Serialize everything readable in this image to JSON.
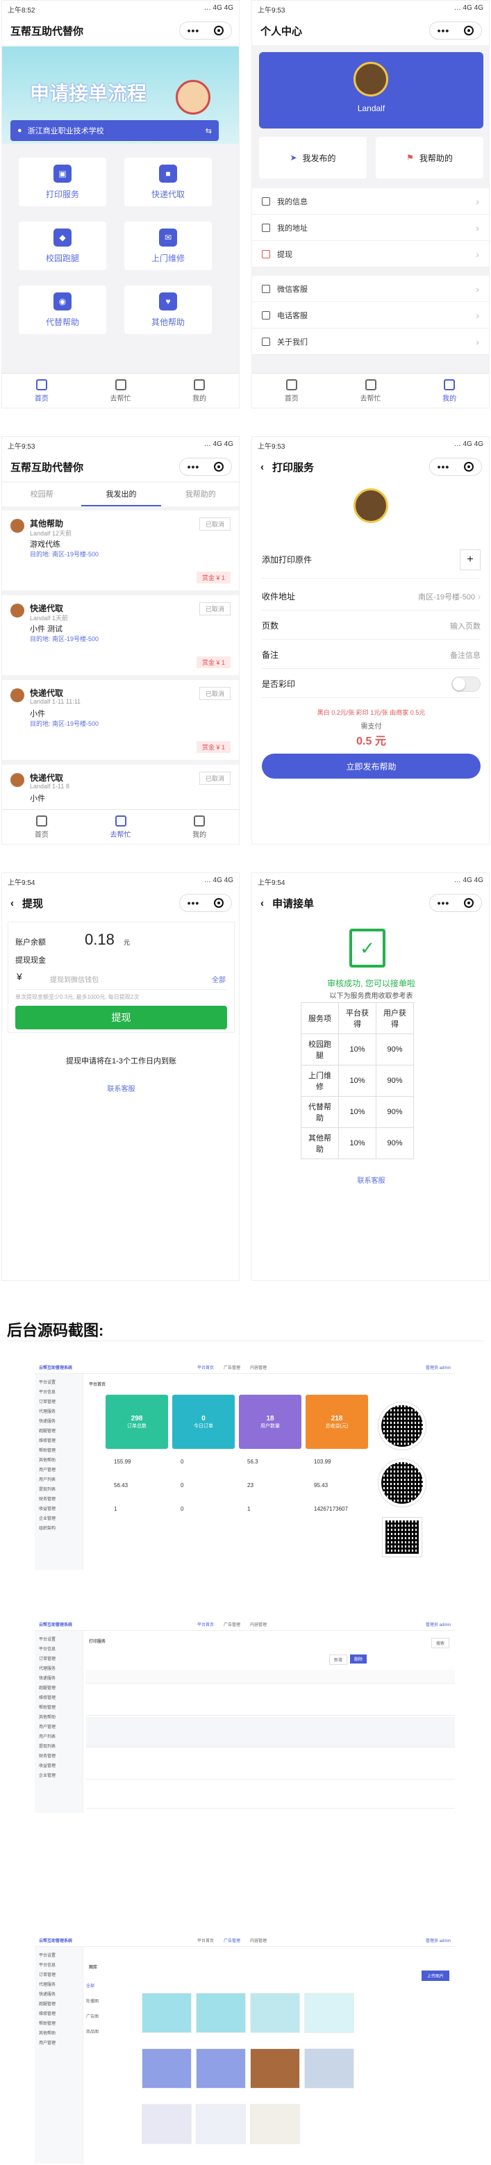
{
  "colors": {
    "accent": "#4a5cd6",
    "green": "#25b14a",
    "red": "#e25555",
    "teal": "#29b6c8",
    "purple": "#8e6fd8",
    "orange": "#f28a2c",
    "greenStat": "#2cc39a"
  },
  "status": {
    "time1": "上午8:52",
    "time2": "上午9:53",
    "time3": "上午9:53",
    "time4": "上午9:53",
    "time5": "上午9:54",
    "time6": "上午9:54",
    "net": "… 4G 4G"
  },
  "home": {
    "title": "互帮互助代替你",
    "banner": "申请接单流程",
    "school": "浙江商业职业技术学校",
    "buttons": [
      "打印服务",
      "快递代取",
      "校园跑腿",
      "上门维修",
      "代替帮助",
      "其他帮助"
    ],
    "tabs": [
      "首页",
      "去帮忙",
      "我的"
    ]
  },
  "profile": {
    "title": "个人中心",
    "name": "Landalf",
    "sent": "我发布的",
    "helped": "我帮助的",
    "menu": [
      "我的信息",
      "我的地址",
      "提现",
      "微信客服",
      "电话客服",
      "关于我们"
    ],
    "tabs": [
      "首页",
      "去帮忙",
      "我的"
    ]
  },
  "orders": {
    "title": "互帮互助代替你",
    "tabs": [
      "校园帮",
      "我发出的",
      "我帮助的"
    ],
    "items": [
      {
        "type": "其他帮助",
        "user": "Landalf 12天前",
        "desc": "游戏代练",
        "dest": "目的地: 南区-19号楼-500",
        "status": "已取消",
        "price": "赏金 ¥ 1"
      },
      {
        "type": "快递代取",
        "user": "Landalf 1天前",
        "desc": "小件 测试",
        "dest": "目的地: 南区-19号楼-500",
        "status": "已取消",
        "price": "赏金 ¥ 1"
      },
      {
        "type": "快递代取",
        "user": "Landalf 1-11 11:11",
        "desc": "小件",
        "dest": "目的地: 南区-19号楼-500",
        "status": "已取消",
        "price": "赏金 ¥ 1"
      },
      {
        "type": "快递代取",
        "user": "Landalf 1-11 8",
        "desc": "小件",
        "dest": "",
        "status": "已取消",
        "price": ""
      }
    ],
    "tabbar": [
      "首页",
      "去帮忙",
      "我的"
    ]
  },
  "print": {
    "title": "打印服务",
    "add": "添加打印原件",
    "addr_label": "收件地址",
    "addr_value": "南区-19号楼-500",
    "pages_label": "页数",
    "pages_value": "输入页数",
    "note_label": "备注",
    "note_value": "备注信息",
    "color_label": "是否彩印",
    "price_note": "黑白 0.2元/张 彩印 1元/张 由商家 0.5元",
    "need_pay": "需支付",
    "amount": "0.5 元",
    "submit": "立即发布帮助"
  },
  "withdraw": {
    "title": "提现",
    "balance_label": "账户余额",
    "balance": "0.18",
    "unit": "元",
    "cash_label": "提现现金",
    "currency": "¥",
    "placeholder": "提现到微信钱包",
    "all": "全部",
    "rule": "单次提现金额至少0.3元, 最多1000元, 每日提现2次",
    "button": "提现",
    "notice": "提现申请将在1-3个工作日内到账",
    "service": "联系客服"
  },
  "apply": {
    "title": "申请接单",
    "success": "审核成功, 您可以接单啦",
    "sub": "以下为服务费用收取参考表",
    "table_head": [
      "服务项",
      "平台获得",
      "用户获得"
    ],
    "rows": [
      [
        "校园跑腿",
        "10%",
        "90%"
      ],
      [
        "上门维修",
        "10%",
        "90%"
      ],
      [
        "代替帮助",
        "10%",
        "90%"
      ],
      [
        "其他帮助",
        "10%",
        "90%"
      ]
    ],
    "service": "联系客服"
  },
  "admin": {
    "heading": "后台源码截图:",
    "logo": "云帮互助管理系统",
    "nav": [
      "平台首页",
      "广告管理",
      "内容管理"
    ],
    "user": "管理员 admin",
    "side": [
      "平台设置",
      "平台信息",
      "订单管理",
      "代理服务",
      "快递服务",
      "跑腿管理",
      "维修管理",
      "帮助管理",
      "其他帮助",
      "用户管理",
      "用户列表",
      "提现列表",
      "财务管理",
      "收益管理",
      "企业管理",
      "组织架构"
    ],
    "dash": {
      "title": "平台首页",
      "stats": [
        [
          "298",
          "订单总数"
        ],
        [
          "0",
          "今日订单"
        ],
        [
          "18",
          "用户数量"
        ],
        [
          "218",
          "总收益(元)"
        ]
      ],
      "values": [
        "155.99",
        "0",
        "56.3",
        "103.99",
        "56.43",
        "0",
        "23",
        "95.43",
        "1",
        "0",
        "1",
        "14267173607"
      ]
    },
    "print_list": {
      "title": "打印服务",
      "search": "搜索",
      "buttons": [
        "新增",
        "删除"
      ]
    },
    "gallery": {
      "title": "图库",
      "upload": "上传图片",
      "cats": [
        "全部",
        "轮播图",
        "广告图",
        "商品图"
      ]
    }
  }
}
